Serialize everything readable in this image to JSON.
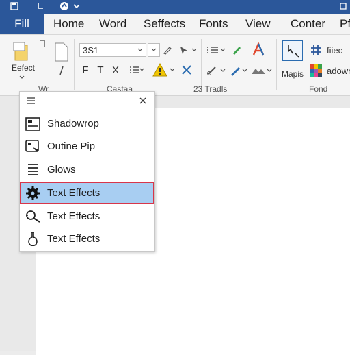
{
  "title_bar": {
    "icons": [
      "save-icon",
      "undo-icon",
      "redo-icon",
      "customize-chevron-icon"
    ],
    "background": "#2b579a"
  },
  "tabs": {
    "file_label": "Fill",
    "items": [
      {
        "label": "Home"
      },
      {
        "label": "Word"
      },
      {
        "label": "Seffects"
      },
      {
        "label": "Fonts"
      },
      {
        "label": "View"
      },
      {
        "label": "Conter"
      },
      {
        "label": "Pf"
      }
    ]
  },
  "ribbon": {
    "select_label": "Eefect",
    "font_size_value": "3S1",
    "font_buttons": [
      "F",
      "T",
      "X"
    ],
    "mapis_label": "Mapis",
    "fiiec_label": "fiiec",
    "adown_label": "adown",
    "group_labels": [
      "Wr",
      "Castaa",
      "23 Tradls",
      "Fond"
    ]
  },
  "menu": {
    "items": [
      {
        "label": "Shadowrop",
        "icon": "shadow-box-icon",
        "selected": false
      },
      {
        "label": "Outine Pip",
        "icon": "outline-box-icon",
        "selected": false
      },
      {
        "label": "Glows",
        "icon": "glow-lines-icon",
        "selected": false
      },
      {
        "label": "Text Effects",
        "icon": "gear-icon",
        "selected": true
      },
      {
        "label": "Text Effects",
        "icon": "magnifier-icon",
        "selected": false
      },
      {
        "label": "Text Effects",
        "icon": "flask-icon",
        "selected": false
      }
    ],
    "selected_background": "#a8cef2",
    "selected_border": "#d8364a"
  }
}
